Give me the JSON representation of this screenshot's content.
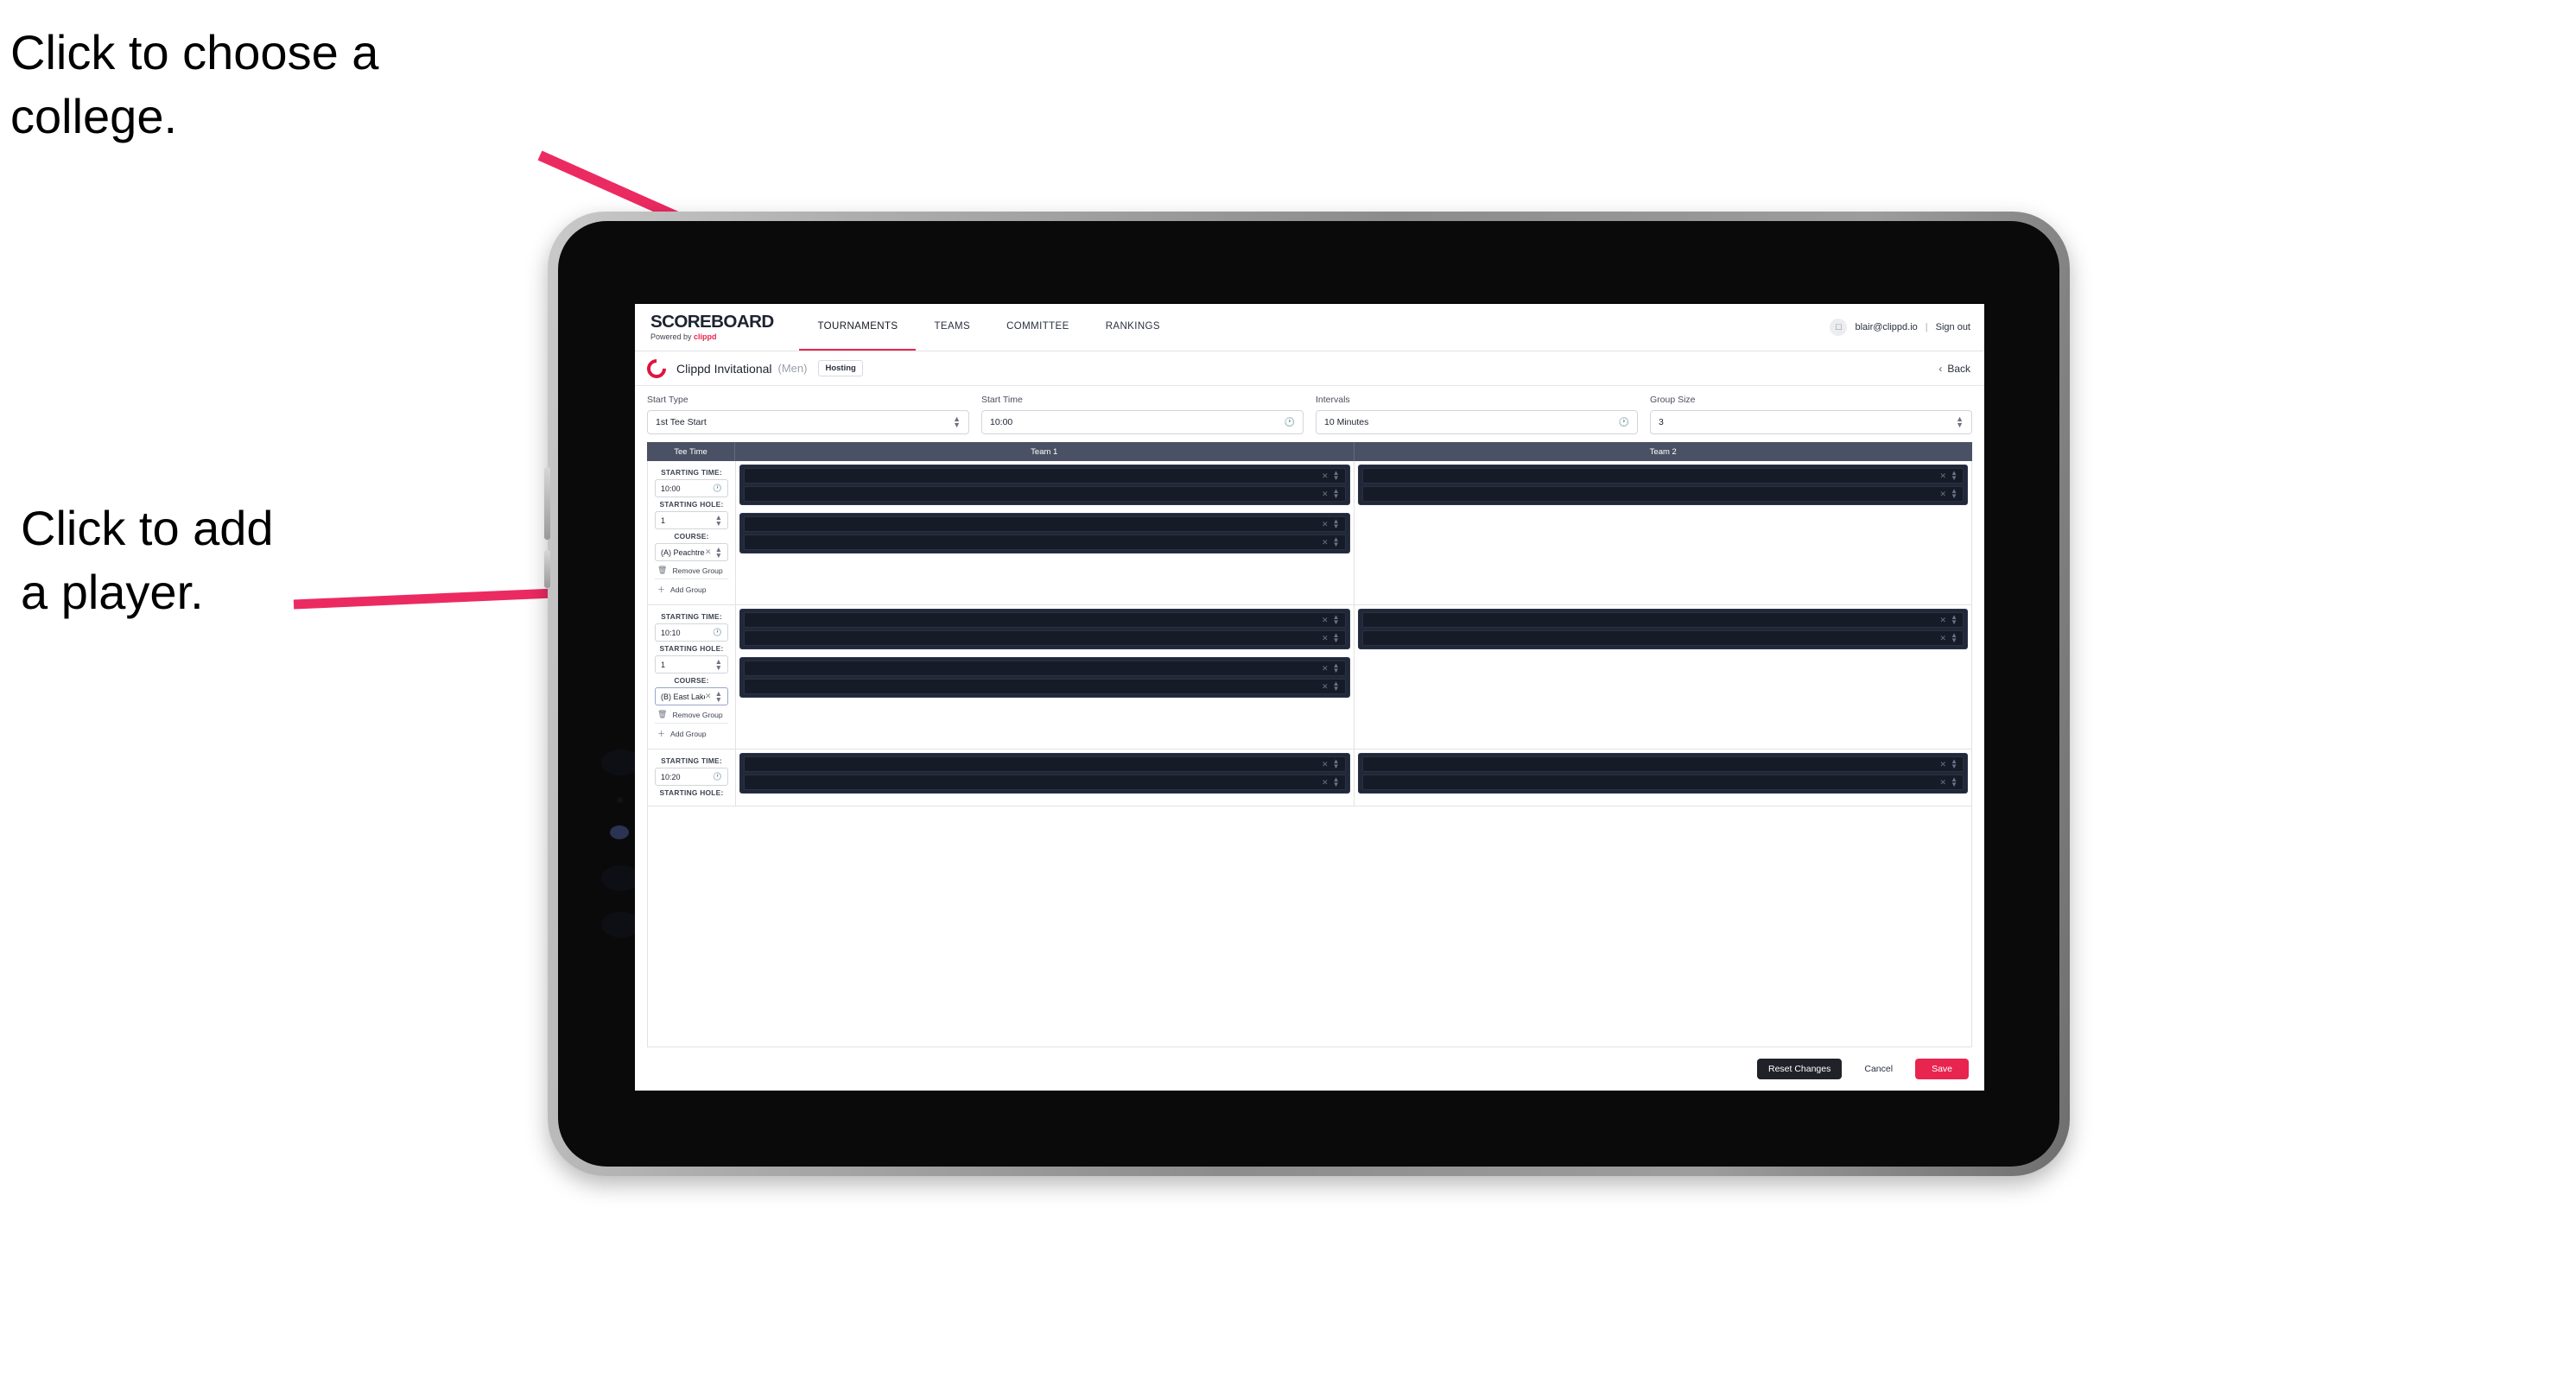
{
  "annotations": {
    "choose_college": "Click to choose a\ncollege.",
    "add_player": "Click to add\na player."
  },
  "colors": {
    "accent_pink": "#e8254f",
    "header_slate": "#4b5164",
    "panel_dark": "#212838",
    "row_dark": "#151b27"
  },
  "app": {
    "brand": {
      "name": "SCOREBOARD",
      "powered_prefix": "Powered by ",
      "powered_brand": "clippd"
    },
    "nav": [
      {
        "label": "TOURNAMENTS",
        "active": true
      },
      {
        "label": "TEAMS",
        "active": false
      },
      {
        "label": "COMMITTEE",
        "active": false
      },
      {
        "label": "RANKINGS",
        "active": false
      }
    ],
    "account": {
      "avatar_icon": "user-avatar-icon",
      "email": "blair@clippd.io",
      "separator": "|",
      "sign_out": "Sign out"
    },
    "tournament": {
      "logo_icon": "clippd-c-logo",
      "name": "Clippd Invitational",
      "gender": "(Men)",
      "badge": "Hosting",
      "back_label": "Back",
      "back_icon": "chevron-left-icon"
    },
    "form": [
      {
        "label": "Start Type",
        "value": "1st Tee Start",
        "icon": "chevron-updown-icon"
      },
      {
        "label": "Start Time",
        "value": "10:00",
        "icon": "clock-icon"
      },
      {
        "label": "Intervals",
        "value": "10 Minutes",
        "icon": "clock-icon"
      },
      {
        "label": "Group Size",
        "value": "3",
        "icon": "chevron-updown-icon"
      }
    ],
    "table": {
      "headers": {
        "tee": "Tee Time",
        "team1": "Team 1",
        "team2": "Team 2"
      },
      "labels": {
        "starting_time": "STARTING TIME:",
        "starting_hole": "STARTING HOLE:",
        "course": "COURSE:",
        "remove_group": "Remove Group",
        "add_group": "Add Group",
        "remove_icon": "trash-icon",
        "add_icon": "plus-icon",
        "clear_icon": "close-x-icon",
        "stepper_icon": "chevron-updown-icon",
        "clock_icon": "clock-icon"
      },
      "rows": [
        {
          "starting_time": "10:00",
          "starting_hole": "1",
          "course": "(A) Peachtree GC",
          "course_focused": false,
          "team1_panels": [
            {
              "players": [
                {
                  "name": ""
                },
                {
                  "name": ""
                }
              ]
            },
            {
              "players": [
                {
                  "name": ""
                },
                {
                  "name": ""
                }
              ]
            }
          ],
          "team2_panels": [
            {
              "players": [
                {
                  "name": ""
                },
                {
                  "name": ""
                }
              ]
            }
          ]
        },
        {
          "starting_time": "10:10",
          "starting_hole": "1",
          "course": "(B) East Lake GC",
          "course_focused": true,
          "team1_panels": [
            {
              "players": [
                {
                  "name": ""
                },
                {
                  "name": ""
                }
              ]
            },
            {
              "players": [
                {
                  "name": ""
                },
                {
                  "name": ""
                }
              ]
            }
          ],
          "team2_panels": [
            {
              "players": [
                {
                  "name": ""
                },
                {
                  "name": ""
                }
              ]
            }
          ]
        },
        {
          "starting_time": "10:20",
          "starting_hole": "",
          "course": "",
          "course_focused": false,
          "partial": true,
          "team1_panels": [
            {
              "players": [
                {
                  "name": ""
                },
                {
                  "name": ""
                }
              ]
            }
          ],
          "team2_panels": [
            {
              "players": [
                {
                  "name": ""
                },
                {
                  "name": ""
                }
              ]
            }
          ]
        }
      ]
    },
    "footer": {
      "reset": "Reset Changes",
      "cancel": "Cancel",
      "save": "Save"
    }
  }
}
